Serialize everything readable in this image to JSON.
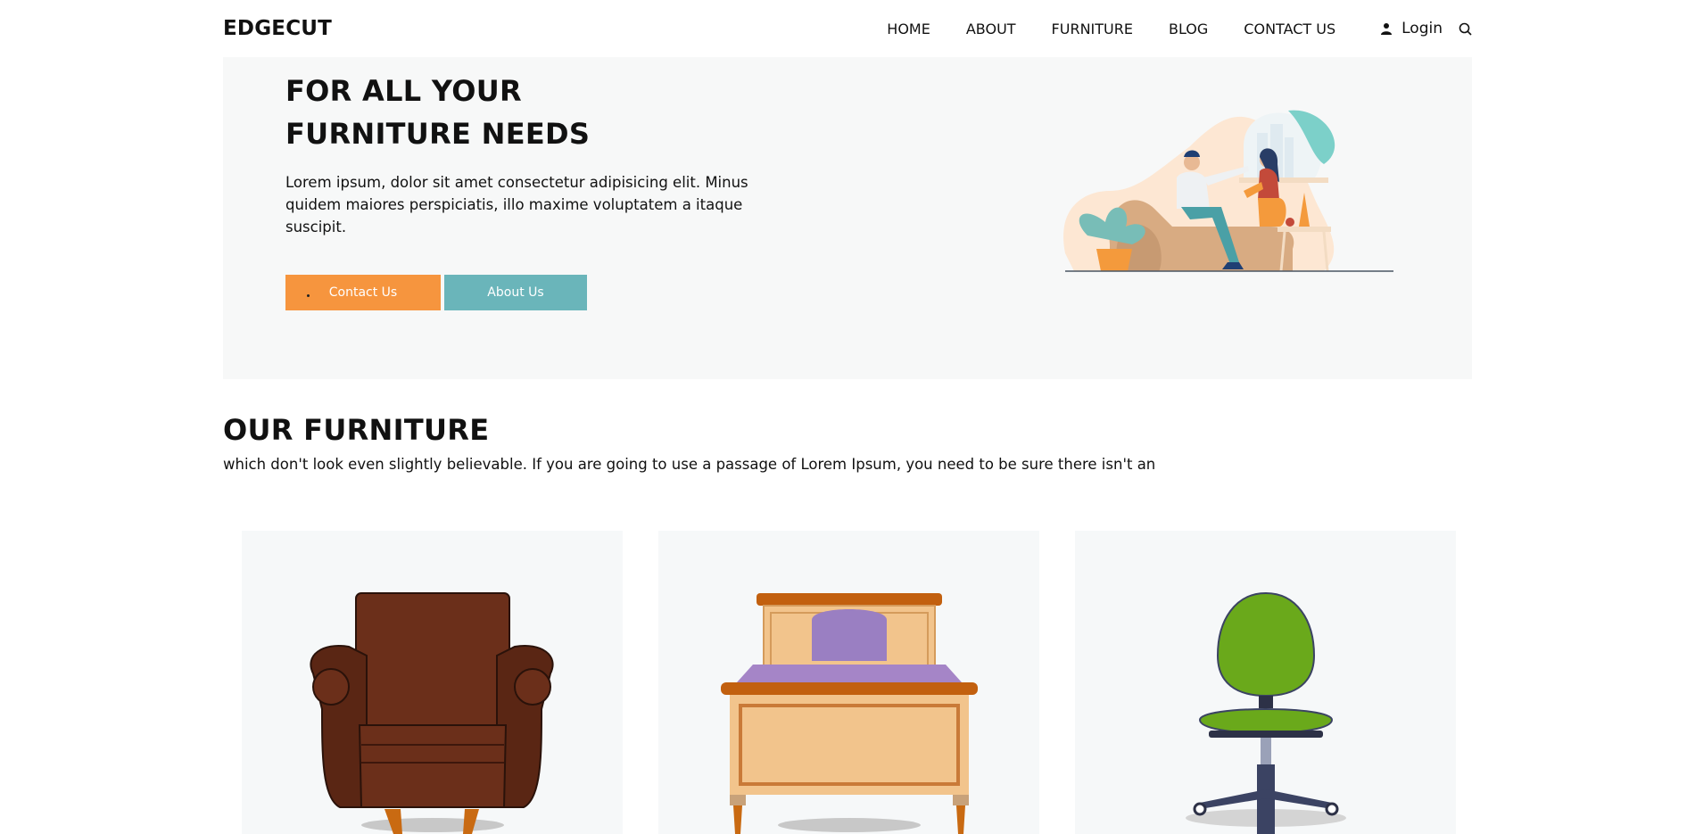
{
  "header": {
    "brand": "EDGECUT",
    "nav": [
      "HOME",
      "ABOUT",
      "FURNITURE",
      "BLOG",
      "CONTACT US"
    ],
    "login": "Login"
  },
  "hero": {
    "title_line1": "FOR ALL YOUR",
    "title_line2": "FURNITURE NEEDS",
    "text": "Lorem ipsum, dolor sit amet consectetur adipisicing elit. Minus quidem maiores perspiciatis, illo maxime voluptatem a itaque suscipit.",
    "contact_label": "Contact Us",
    "about_label": "About Us"
  },
  "section": {
    "title": "OUR FURNITURE",
    "subtitle": "which don't look even slightly believable. If you are going to use a passage of Lorem Ipsum, you need to be sure there isn't an"
  },
  "colors": {
    "contact_button": "#f6953e",
    "about_button": "#6ab5ba",
    "hero_bg": "#f7f8f8",
    "card_bg": "#f6f8f9"
  },
  "icons": [
    "user-icon",
    "search-icon"
  ],
  "products": [
    "armchair-illustration",
    "bed-illustration",
    "office-chair-illustration"
  ]
}
